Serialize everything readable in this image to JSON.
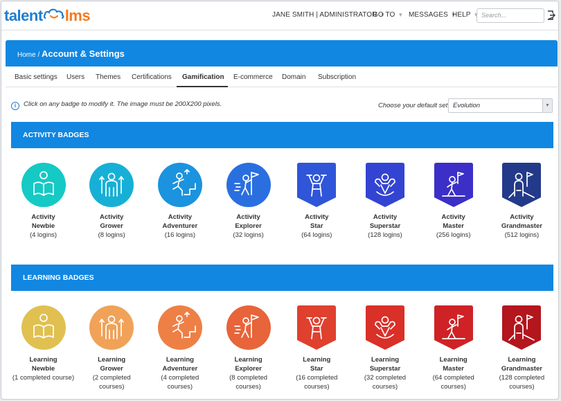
{
  "app": {
    "logo_left": "talent",
    "logo_right": "lms"
  },
  "topnav": {
    "user": "JANE SMITH | ADMINISTRATOR",
    "goto": "GO TO",
    "messages": "MESSAGES",
    "help": "HELP",
    "search_placeholder": "Search..."
  },
  "breadcrumb": {
    "home": "Home /",
    "current": "Account & Settings"
  },
  "tabs": [
    "Basic settings",
    "Users",
    "Themes",
    "Certifications",
    "Gamification",
    "E-commerce",
    "Domain",
    "Subscription"
  ],
  "active_tab": "Gamification",
  "info": {
    "text": "Click on any badge to modify it. The image must be 200X200 pixels.",
    "default_set_label": "Choose your default set",
    "default_set_value": "Evolution"
  },
  "sections": {
    "activity": {
      "title": "ACTIVITY BADGES",
      "badges": [
        {
          "line1": "Activity",
          "line2": "Newbie",
          "req": [
            "(4 logins)"
          ],
          "color": "#15c9c4",
          "shape": "circle",
          "icon": "reader-icon"
        },
        {
          "line1": "Activity",
          "line2": "Grower",
          "req": [
            "(8 logins)"
          ],
          "color": "#16b0d6",
          "shape": "circle",
          "icon": "grower-icon"
        },
        {
          "line1": "Activity",
          "line2": "Adventurer",
          "req": [
            "(16 logins)"
          ],
          "color": "#1b93de",
          "shape": "circle",
          "icon": "climber-icon"
        },
        {
          "line1": "Activity",
          "line2": "Explorer",
          "req": [
            "(32 logins)"
          ],
          "color": "#2a6fe0",
          "shape": "circle",
          "icon": "explorer-icon"
        },
        {
          "line1": "Activity",
          "line2": "Star",
          "req": [
            "(64 logins)"
          ],
          "color": "#2f55d8",
          "shape": "shield",
          "icon": "star-icon"
        },
        {
          "line1": "Activity",
          "line2": "Superstar",
          "req": [
            "(128 logins)"
          ],
          "color": "#3344d2",
          "shape": "shield",
          "icon": "superstar-icon"
        },
        {
          "line1": "Activity",
          "line2": "Master",
          "req": [
            "(256 logins)"
          ],
          "color": "#3b2fc8",
          "shape": "shield",
          "icon": "master-icon"
        },
        {
          "line1": "Activity",
          "line2": "Grandmaster",
          "req": [
            "(512 logins)"
          ],
          "color": "#233a8a",
          "shape": "shield",
          "icon": "grandmaster-icon"
        }
      ]
    },
    "learning": {
      "title": "LEARNING BADGES",
      "badges": [
        {
          "line1": "Learning",
          "line2": "Newbie",
          "req": [
            "(1 completed course)"
          ],
          "color": "#e0c050",
          "shape": "circle",
          "icon": "reader-icon"
        },
        {
          "line1": "Learning",
          "line2": "Grower",
          "req": [
            "(2 completed",
            "courses)"
          ],
          "color": "#f0a258",
          "shape": "circle",
          "icon": "grower-icon"
        },
        {
          "line1": "Learning",
          "line2": "Adventurer",
          "req": [
            "(4 completed",
            "courses)"
          ],
          "color": "#ee8046",
          "shape": "circle",
          "icon": "climber-icon"
        },
        {
          "line1": "Learning",
          "line2": "Explorer",
          "req": [
            "(8 completed",
            "courses)"
          ],
          "color": "#e8643a",
          "shape": "circle",
          "icon": "explorer-icon"
        },
        {
          "line1": "Learning",
          "line2": "Star",
          "req": [
            "(16 completed",
            "courses)"
          ],
          "color": "#e0402e",
          "shape": "shield",
          "icon": "star-icon"
        },
        {
          "line1": "Learning",
          "line2": "Superstar",
          "req": [
            "(32 completed",
            "courses)"
          ],
          "color": "#d93028",
          "shape": "shield",
          "icon": "superstar-icon"
        },
        {
          "line1": "Learning",
          "line2": "Master",
          "req": [
            "(64 completed",
            "courses)"
          ],
          "color": "#cf2226",
          "shape": "shield",
          "icon": "master-icon"
        },
        {
          "line1": "Learning",
          "line2": "Grandmaster",
          "req": [
            "(128 completed",
            "courses)"
          ],
          "color": "#b3161d",
          "shape": "shield",
          "icon": "grandmaster-icon"
        }
      ]
    }
  }
}
